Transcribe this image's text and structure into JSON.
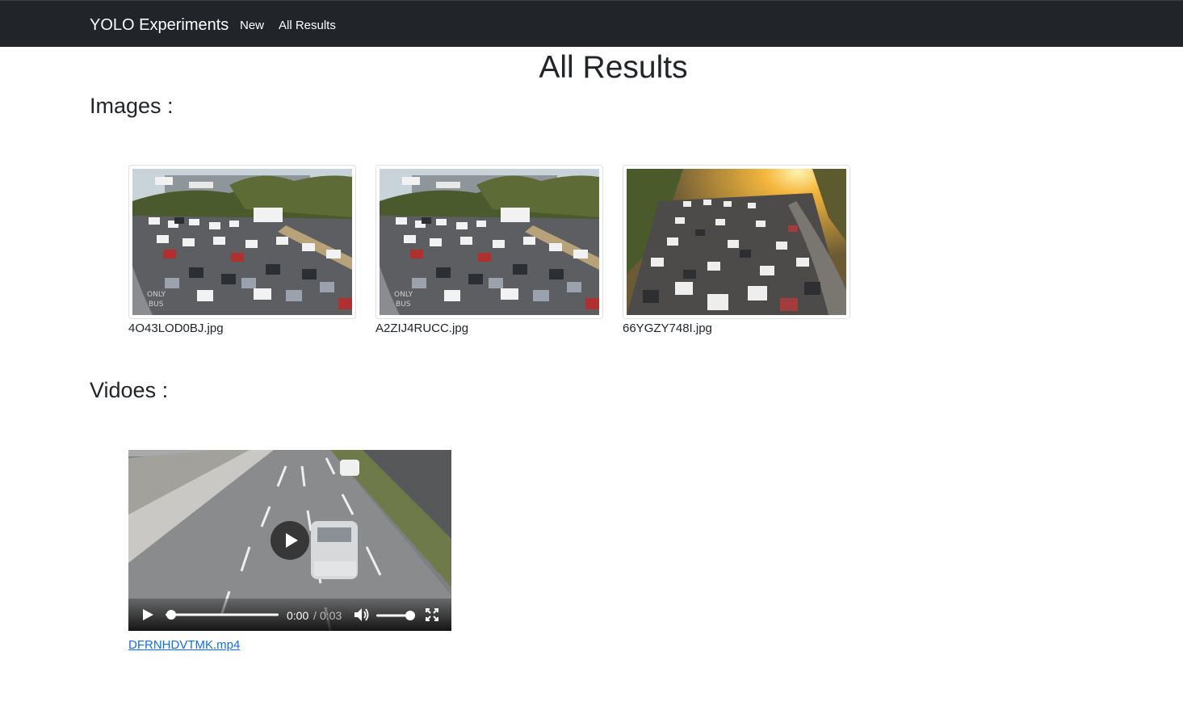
{
  "navbar": {
    "brand": "YOLO Experiments",
    "links": [
      {
        "label": "New"
      },
      {
        "label": "All Results"
      }
    ]
  },
  "page": {
    "title": "All Results",
    "images_heading": "Images :",
    "videos_heading": "Vidoes :"
  },
  "images": [
    {
      "filename": "4O43LOD0BJ.jpg",
      "scene": "traffic-jam-daylight"
    },
    {
      "filename": "A2ZIJ4RUCC.jpg",
      "scene": "traffic-jam-daylight"
    },
    {
      "filename": "66YGZY748I.jpg",
      "scene": "traffic-sunset"
    }
  ],
  "videos": [
    {
      "filename": "DFRNHDVTMK.mp4",
      "current_time": "0:00",
      "separator": "/",
      "duration": "0:03",
      "progress": 0,
      "volume": 1
    }
  ],
  "colors": {
    "navbar_bg": "#212529",
    "link": "#0d6efd",
    "text": "#212529"
  }
}
